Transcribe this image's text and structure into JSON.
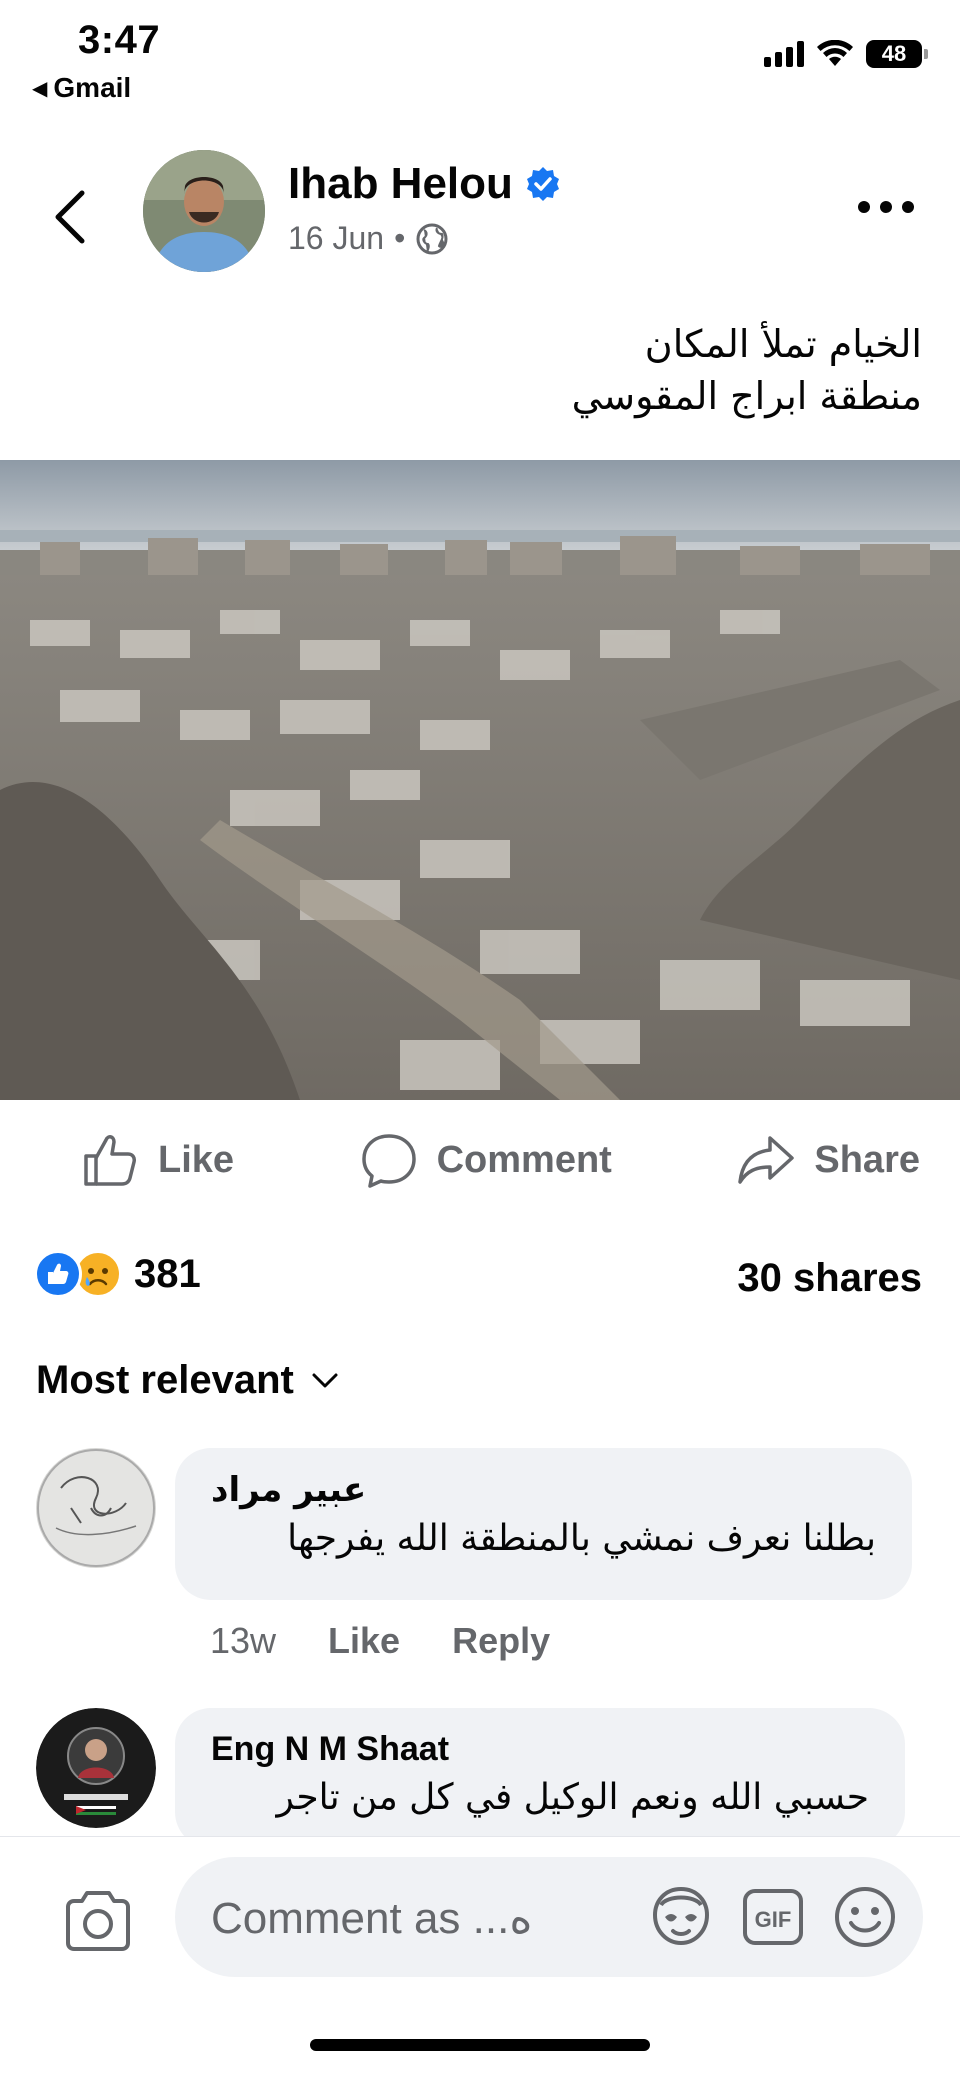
{
  "status_bar": {
    "time": "3:47",
    "back_app": "Gmail",
    "battery": "48"
  },
  "post": {
    "author": "Ihab Helou",
    "date": "16 Jun",
    "separator": "•",
    "text_line1": "الخيام تملأ المكان",
    "text_line2": "منطقة ابراج المقوسي",
    "image_alt": "Aerial view of tents filling area among destroyed buildings"
  },
  "actions": {
    "like": "Like",
    "comment": "Comment",
    "share": "Share"
  },
  "stats": {
    "reaction_count": "381",
    "shares": "30 shares"
  },
  "sort": {
    "label": "Most relevant"
  },
  "comments": [
    {
      "name": "عبير مراد",
      "text": "بطلنا نعرف نمشي بالمنطقة الله يفرجها",
      "time": "13w",
      "like": "Like",
      "reply": "Reply"
    },
    {
      "name": "Eng N M Shaat",
      "text": "حسبي الله ونعم الوكيل في كل من تاجر"
    }
  ],
  "composer": {
    "placeholder": "Comment as ...ه"
  },
  "icons": {
    "back": "chevron-left-icon",
    "verified": "verified-badge-icon",
    "globe": "globe-icon",
    "more": "more-horizontal-icon",
    "camera": "camera-icon",
    "avatar_sticker": "avatar-sticker-icon",
    "gif": "gif-icon",
    "emoji": "emoji-icon"
  },
  "colors": {
    "accent": "#1877f2",
    "secondary_text": "#65676b",
    "bubble": "#f0f2f5"
  }
}
